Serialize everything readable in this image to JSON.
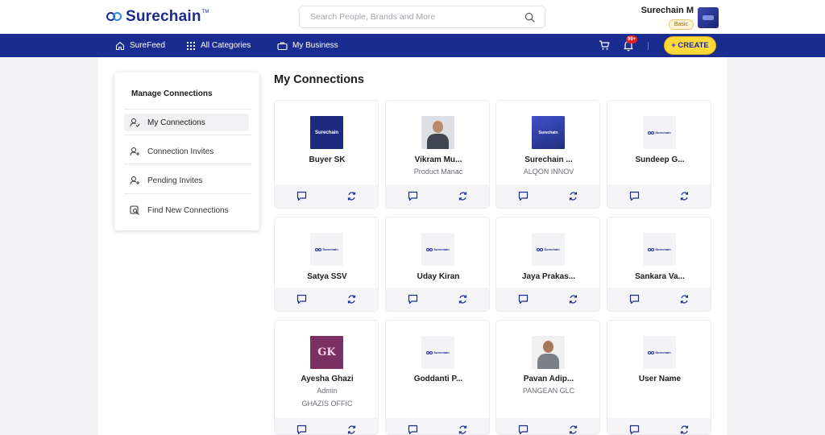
{
  "header": {
    "logo_text": "Surechain",
    "logo_tm": "TM",
    "search_placeholder": "Search People, Brands and More",
    "user_name": "Surechain M",
    "user_plan": "Basic"
  },
  "nav": {
    "surefeed": "SureFeed",
    "all_categories": "All Categories",
    "my_business": "My Business",
    "notification_count": "99+",
    "create_label": "+ CREATE"
  },
  "sidebar": {
    "title": "Manage Connections",
    "items": [
      {
        "label": "My Connections",
        "icon": "user-check-icon",
        "active": true
      },
      {
        "label": "Connection Invites",
        "icon": "user-plus-icon"
      },
      {
        "label": "Pending Invites",
        "icon": "user-plus-icon"
      },
      {
        "label": "Find New Connections",
        "icon": "search-user-icon"
      }
    ]
  },
  "main": {
    "title": "My Connections",
    "connections": [
      {
        "name": "Buyer SK",
        "subtitle": "",
        "company": "",
        "image": "surechain-navy-logo"
      },
      {
        "name": "Vikram Mu...",
        "subtitle": "Product Manac",
        "company": "",
        "image": "person-photo"
      },
      {
        "name": "Surechain ...",
        "subtitle": "ALQON INNOV",
        "company": "",
        "image": "surechain-magazine"
      },
      {
        "name": "Sundeep G...",
        "subtitle": "",
        "company": "",
        "image": "placeholder-logo"
      },
      {
        "name": "Satya SSV",
        "subtitle": "",
        "company": "",
        "image": "placeholder-logo"
      },
      {
        "name": "Uday Kiran",
        "subtitle": "",
        "company": "",
        "image": "placeholder-logo"
      },
      {
        "name": "Jaya Prakas...",
        "subtitle": "",
        "company": "",
        "image": "placeholder-logo"
      },
      {
        "name": "Sankara Va...",
        "subtitle": "",
        "company": "",
        "image": "placeholder-logo"
      },
      {
        "name": "Ayesha Ghazi",
        "subtitle": "Admin",
        "company": "GHAZIS OFFIC",
        "image": "gk-logo"
      },
      {
        "name": "Goddanti P...",
        "subtitle": "",
        "company": "",
        "image": "placeholder-logo"
      },
      {
        "name": "Pavan Adip...",
        "subtitle": "PANGEAN GLC",
        "company": "",
        "image": "person-photo"
      },
      {
        "name": "User Name",
        "subtitle": "",
        "company": "",
        "image": "placeholder-logo"
      }
    ]
  },
  "image_text": {
    "surechain": "Surechain",
    "gk": "GK"
  },
  "colors": {
    "brand_navy": "#1b2c91",
    "create_yellow": "#ffd93b",
    "notification_red": "#e02424"
  }
}
